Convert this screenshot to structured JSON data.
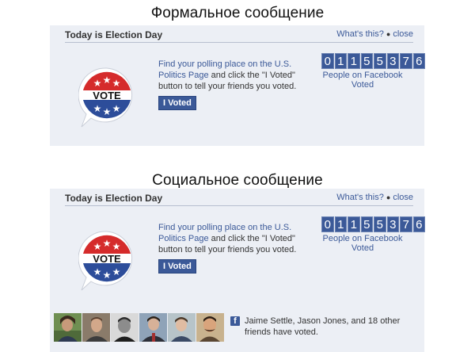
{
  "formal": {
    "heading": "Формальное сообщение",
    "panel_title": "Today is Election Day",
    "whats_this": "What's this?",
    "close": "close",
    "badge_text": "VOTE",
    "message_link": "Find your polling place on the U.S. Politics Page",
    "message_rest": " and click the \"I Voted\" button to tell your friends you voted.",
    "button_label": "I Voted",
    "counter_digits": [
      "0",
      "1",
      "1",
      "5",
      "5",
      "3",
      "7",
      "6"
    ],
    "counter_label": "People on Facebook Voted"
  },
  "social": {
    "heading": "Социальное сообщение",
    "panel_title": "Today is Election Day",
    "whats_this": "What's this?",
    "close": "close",
    "badge_text": "VOTE",
    "message_link": "Find your polling place on the U.S. Politics Page",
    "message_rest": " and click the \"I Voted\" button to tell your friends you voted.",
    "button_label": "I Voted",
    "counter_digits": [
      "0",
      "1",
      "1",
      "5",
      "5",
      "3",
      "7",
      "6"
    ],
    "counter_label": "People on Facebook Voted",
    "friends_text": "Jaime Settle, Jason Jones, and 18 other friends have voted.",
    "friend_count": 6
  },
  "colors": {
    "panel_bg": "#eceff5",
    "facebook_blue": "#3b5998",
    "badge_red": "#d52b2b",
    "badge_blue": "#2d4d9a"
  },
  "icons": [
    "vote-badge-icon",
    "facebook-icon",
    "friend-photo"
  ]
}
